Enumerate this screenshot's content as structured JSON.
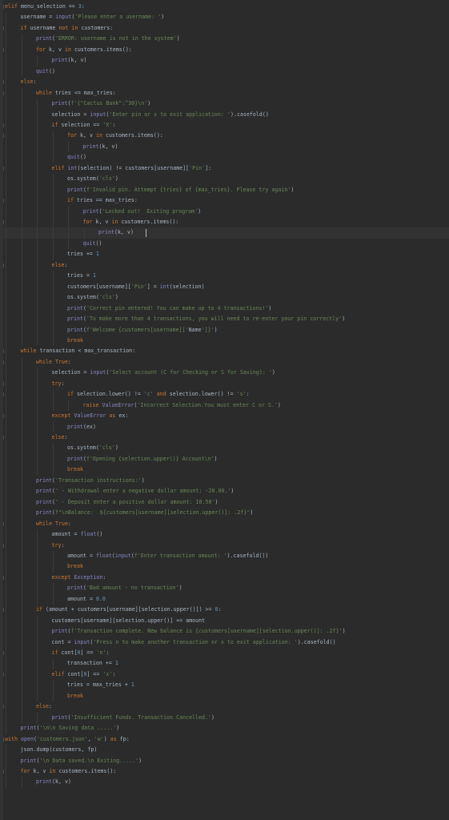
{
  "editor": {
    "language": "python",
    "colors": {
      "background": "#2b2b2b",
      "keyword": "#cc7832",
      "string": "#6a8759",
      "number": "#6897bb",
      "builtin": "#8888c6",
      "identifier": "#a9b7c6"
    },
    "lines": [
      {
        "indent": 0,
        "code": "elif menu_selection == 3:"
      },
      {
        "indent": 1,
        "code": "username = input('Please enter a username: ')"
      },
      {
        "indent": 1,
        "code": "if username not in customers:"
      },
      {
        "indent": 2,
        "code": "print('ERROR: username is not in the system')"
      },
      {
        "indent": 2,
        "code": "for k, v in customers.items():"
      },
      {
        "indent": 3,
        "code": "print(k, v)"
      },
      {
        "indent": 2,
        "code": "quit()"
      },
      {
        "indent": 1,
        "code": "else:"
      },
      {
        "indent": 2,
        "code": "while tries <= max_tries:"
      },
      {
        "indent": 3,
        "code": "print(f'{\"Cactus Bank\":^30}\\n')"
      },
      {
        "indent": 3,
        "code": "selection = input('Enter pin or x to exit application: ').casefold()"
      },
      {
        "indent": 3,
        "code": "if selection == 'X':"
      },
      {
        "indent": 4,
        "code": "for k, v in customers.items():"
      },
      {
        "indent": 5,
        "code": "print(k, v)"
      },
      {
        "indent": 4,
        "code": "quit()"
      },
      {
        "indent": 3,
        "code": "elif int(selection) != customers[username]['Pin']:"
      },
      {
        "indent": 4,
        "code": "os.system('cls')"
      },
      {
        "indent": 4,
        "code": "print(f'Invalid pin. Attempt {tries} of {max_tries}. Please try again')"
      },
      {
        "indent": 4,
        "code": "if tries == max_tries:"
      },
      {
        "indent": 5,
        "code": "print('Locked out!  Exiting program')"
      },
      {
        "indent": 5,
        "code": "for k, v in customers.items():"
      },
      {
        "indent": 6,
        "code": "print(k, v)"
      },
      {
        "indent": 5,
        "code": "quit()"
      },
      {
        "indent": 4,
        "code": "tries += 1"
      },
      {
        "indent": 3,
        "code": "else:"
      },
      {
        "indent": 4,
        "code": "tries = 1"
      },
      {
        "indent": 4,
        "code": "customers[username]['Pin'] = int(selection)"
      },
      {
        "indent": 4,
        "code": "os.system('cls')"
      },
      {
        "indent": 4,
        "code": "print('Correct pin entered! You can make up to 4 transactions!')"
      },
      {
        "indent": 4,
        "code": "print('To make more than 4 transactions, you will need to re-enter your pin correctly')"
      },
      {
        "indent": 4,
        "code": "print(f'Welcome {customers[username]['Name']}')"
      },
      {
        "indent": 4,
        "code": "break"
      },
      {
        "indent": 1,
        "code": "while transaction < max_transaction:"
      },
      {
        "indent": 2,
        "code": "while True:"
      },
      {
        "indent": 3,
        "code": "selection = input('Select account (C for Checking or S for Saving): ')"
      },
      {
        "indent": 3,
        "code": "try:"
      },
      {
        "indent": 4,
        "code": "if selection.lower() != 'c' and selection.lower() != 's':"
      },
      {
        "indent": 5,
        "code": "raise ValueError('Incorrect Selection.You must enter C or S.')"
      },
      {
        "indent": 3,
        "code": "except ValueError as ex:"
      },
      {
        "indent": 4,
        "code": "print(ex)"
      },
      {
        "indent": 3,
        "code": "else:"
      },
      {
        "indent": 4,
        "code": "os.system('cls')"
      },
      {
        "indent": 4,
        "code": "print(f'Opening {selection.upper()} Account\\n')"
      },
      {
        "indent": 4,
        "code": "break"
      },
      {
        "indent": 2,
        "code": "print('Transaction instructions:')"
      },
      {
        "indent": 2,
        "code": "print(' - Withdrawal enter a negative dollar amount: -20.00.')"
      },
      {
        "indent": 2,
        "code": "print(' - Deposit enter a positive dollar amount: 10.50')"
      },
      {
        "indent": 2,
        "code": "print(f\"\\nBalance:  ${customers[username][selection.upper()]: .2f}\")"
      },
      {
        "indent": 2,
        "code": "while True:"
      },
      {
        "indent": 3,
        "code": "amount = float()"
      },
      {
        "indent": 3,
        "code": "try:"
      },
      {
        "indent": 4,
        "code": "amount = float(input(f'Enter transaction amount: ').casefold())"
      },
      {
        "indent": 4,
        "code": "break"
      },
      {
        "indent": 3,
        "code": "except Exception:"
      },
      {
        "indent": 4,
        "code": "print('Bad amount - no transaction')"
      },
      {
        "indent": 4,
        "code": "amount = 0.0"
      },
      {
        "indent": 2,
        "code": "if (amount + customers[username][selection.upper()]) >= 0:"
      },
      {
        "indent": 3,
        "code": "customers[username][selection.upper()] += amount"
      },
      {
        "indent": 3,
        "code": "print(f'Transaction complete. New balance is {customers[username][selection.upper()]: .2f}')"
      },
      {
        "indent": 3,
        "code": "cont = input('Press n to make another transaction or x to exit application: ').casefold()"
      },
      {
        "indent": 3,
        "code": "if cont[0] == 'n':"
      },
      {
        "indent": 4,
        "code": "transaction += 1"
      },
      {
        "indent": 3,
        "code": "elif cont[0] == 'x':"
      },
      {
        "indent": 4,
        "code": "tries = max_tries + 1"
      },
      {
        "indent": 4,
        "code": "break"
      },
      {
        "indent": 2,
        "code": "else:"
      },
      {
        "indent": 3,
        "code": "print('Insufficient Funds. Transaction Cancelled.')"
      },
      {
        "indent": 1,
        "code": "print('\\n\\n Saving data .....')"
      },
      {
        "indent": 0,
        "code": "with open('customers.json', 'w') as fp:"
      },
      {
        "indent": 1,
        "code": "json.dump(customers, fp)"
      },
      {
        "indent": 1,
        "code": "print('\\n Data saved.\\n Exiting.....')"
      },
      {
        "indent": 1,
        "code": "for k, v in customers.items():"
      },
      {
        "indent": 2,
        "code": "print(k, v)"
      }
    ]
  }
}
